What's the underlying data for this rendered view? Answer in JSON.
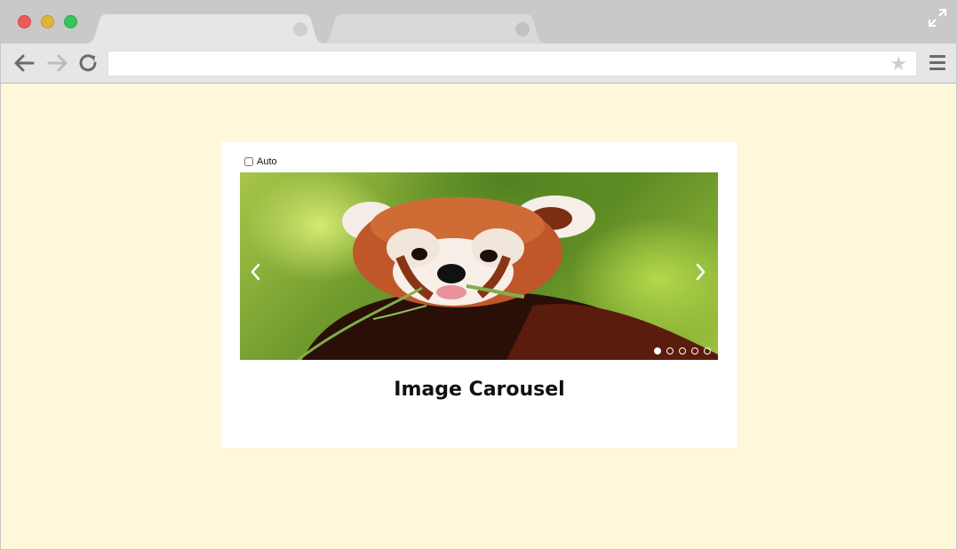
{
  "browser": {
    "address_value": "",
    "address_placeholder": ""
  },
  "page": {
    "auto_label": "Auto",
    "auto_checked": false,
    "caption": "Image Carousel",
    "slide_count": 5,
    "active_slide": 1
  }
}
